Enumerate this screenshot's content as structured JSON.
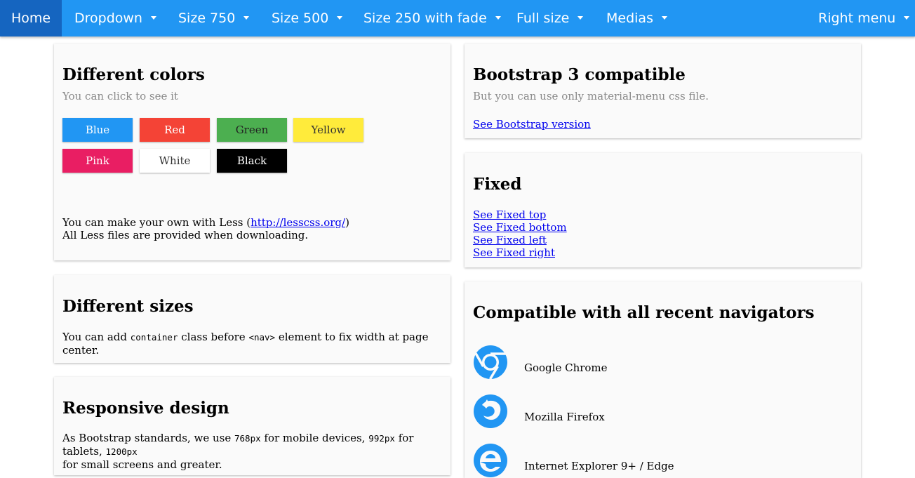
{
  "nav": {
    "items": [
      {
        "label": "Home",
        "caret": false,
        "active": true
      },
      {
        "label": "Dropdown",
        "caret": true
      },
      {
        "label": "Size 750",
        "caret": true
      },
      {
        "label": "Size 500",
        "caret": true
      },
      {
        "label": "Size 250 with fade",
        "caret": true
      },
      {
        "label": "Full size",
        "caret": true
      },
      {
        "label": "Medias",
        "caret": true
      }
    ],
    "right": {
      "label": "Right menu",
      "caret": true
    },
    "color": "#2196f3",
    "active_color": "#1565c0"
  },
  "colors_card": {
    "title": "Different colors",
    "subtitle": "You can click to see it",
    "swatches": [
      {
        "label": "Blue",
        "bg": "#2196f3",
        "fg": "#ffffff"
      },
      {
        "label": "Red",
        "bg": "#f44336",
        "fg": "#ffffff"
      },
      {
        "label": "Green",
        "bg": "#4caf50",
        "fg": "#222222"
      },
      {
        "label": "Yellow",
        "bg": "#ffeb3b",
        "fg": "#333333"
      },
      {
        "label": "Pink",
        "bg": "#e91e63",
        "fg": "#ffffff"
      },
      {
        "label": "White",
        "bg": "#ffffff",
        "fg": "#333333"
      },
      {
        "label": "Black",
        "bg": "#000000",
        "fg": "#ffffff"
      }
    ],
    "less_prefix": "You can make your own with Less (",
    "less_link": "http://lesscss.org/",
    "less_suffix": ")",
    "less_line2": "All Less files are provided when downloading."
  },
  "sizes_card": {
    "title": "Different sizes",
    "text_before": "You can add ",
    "code1": "container",
    "text_mid": " class before ",
    "code2": "<nav>",
    "text_after": " element to fix width at page center."
  },
  "responsive_card": {
    "title": "Responsive design",
    "t1": "As Bootstrap standards, we use ",
    "c1": "768px",
    "t2": " for mobile devices, ",
    "c2": "992px",
    "t3": " for tablets, ",
    "c3": "1200px",
    "t4": "for small screens and greater."
  },
  "bootstrap_card": {
    "title": "Bootstrap 3 compatible",
    "subtitle": "But you can use only material-menu css file.",
    "link": "See Bootstrap version"
  },
  "fixed_card": {
    "title": "Fixed",
    "links": [
      "See Fixed top",
      "See Fixed bottom",
      "See Fixed left",
      "See Fixed right"
    ]
  },
  "browsers_card": {
    "title": "Compatible with all recent navigators",
    "browsers": [
      {
        "name": "Google Chrome",
        "icon": "chrome-icon"
      },
      {
        "name": "Mozilla Firefox",
        "icon": "firefox-icon"
      },
      {
        "name": "Internet Explorer 9+ / Edge",
        "icon": "ie-edge-icon"
      }
    ],
    "icon_color": "#2196f3"
  }
}
